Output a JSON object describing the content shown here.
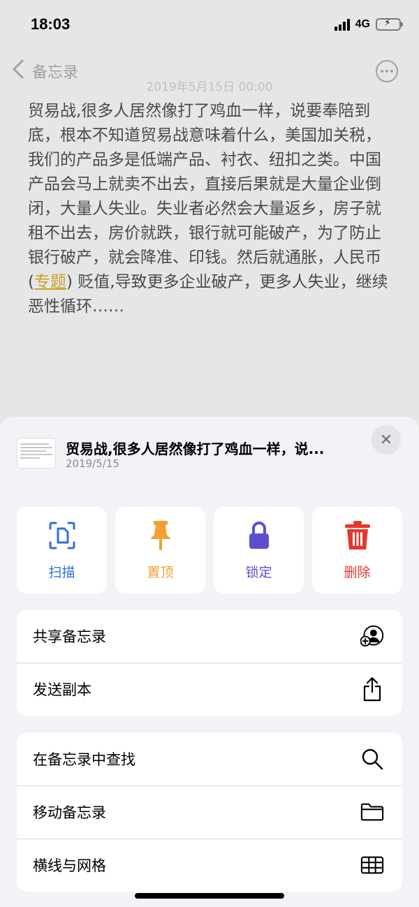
{
  "status_bar": {
    "time": "18:03",
    "network": "4G"
  },
  "nav": {
    "back_label": "备忘录",
    "date": "2019年5月15日 00:00"
  },
  "note": {
    "text_before_link": "贸易战,很多人居然像打了鸡血一样，说要奉陪到底，根本不知道贸易战意味着什么，美国加关税，我们的产品多是低端产品、衬衣、纽扣之类。中国产品会马上就卖不出去，直接后果就是大量企业倒闭，大量人失业。失业者必然会大量返乡，房子就租不出去，房价就跌，银行就可能破产，为了防止银行破产，就会降准、印钱。然后就通胀，人民币 (",
    "link_text": "专题",
    "text_after_link": ") 贬值,导致更多企业破产，更多人失业，继续恶性循环……"
  },
  "sheet": {
    "title": "贸易战,很多人居然像打了鸡血一样，说...",
    "subtitle": "2019/5/15",
    "actions": [
      {
        "label": "扫描",
        "icon": "scan-document-icon",
        "color": "#2f6fe0"
      },
      {
        "label": "置顶",
        "icon": "pin-icon",
        "color": "#f0a030"
      },
      {
        "label": "锁定",
        "icon": "lock-icon",
        "color": "#5b4fd0"
      },
      {
        "label": "删除",
        "icon": "trash-icon",
        "color": "#e5372c"
      }
    ],
    "group1": [
      {
        "label": "共享备忘录",
        "icon": "add-person-icon"
      },
      {
        "label": "发送副本",
        "icon": "share-icon"
      }
    ],
    "group2": [
      {
        "label": "在备忘录中查找",
        "icon": "search-icon"
      },
      {
        "label": "移动备忘录",
        "icon": "folder-icon"
      },
      {
        "label": "横线与网格",
        "icon": "grid-icon"
      }
    ]
  }
}
